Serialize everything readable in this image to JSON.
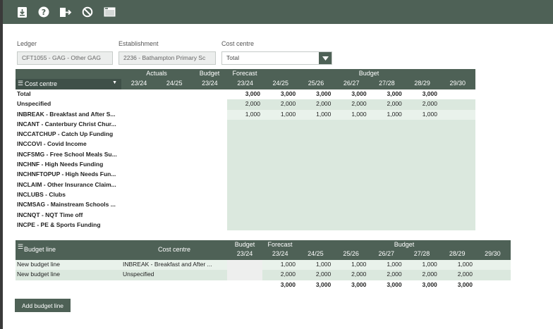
{
  "toolbar": {
    "icons": [
      "download-icon",
      "help-icon",
      "export-icon",
      "cancel-icon",
      "window-icon"
    ]
  },
  "filters": {
    "ledger": {
      "label": "Ledger",
      "value": "CFT1055 - GAG - Other GAG"
    },
    "establishment": {
      "label": "Establishment",
      "value": "2236 - Bathampton Primary Sc"
    },
    "cost_centre": {
      "label": "Cost centre",
      "value": "Total"
    }
  },
  "top_grid": {
    "groups": {
      "actuals": "Actuals",
      "budget": "Budget",
      "forecast": "Forecast",
      "budget2": "Budget"
    },
    "first_col": "Cost centre",
    "years": [
      "23/24",
      "24/25",
      "23/24",
      "23/24",
      "24/25",
      "25/26",
      "26/27",
      "27/28",
      "28/29",
      "29/30"
    ],
    "rows": [
      {
        "label": "Total",
        "bold": true,
        "values": [
          "3,000",
          "3,000",
          "3,000",
          "3,000",
          "3,000",
          "3,000"
        ]
      },
      {
        "label": "Unspecified",
        "values": [
          "2,000",
          "2,000",
          "2,000",
          "2,000",
          "2,000",
          "2,000"
        ]
      },
      {
        "label": "INBREAK - Breakfast and After S...",
        "values": [
          "1,000",
          "1,000",
          "1,000",
          "1,000",
          "1,000",
          "1,000"
        ]
      },
      {
        "label": "INCANT - Canterbury Christ Chur...",
        "values": []
      },
      {
        "label": "INCCATCHUP - Catch Up Funding",
        "values": []
      },
      {
        "label": "INCCOVI - Covid Income",
        "values": []
      },
      {
        "label": "INCFSMG - Free School Meals Su...",
        "values": []
      },
      {
        "label": "INCHNF - High Needs Funding",
        "values": []
      },
      {
        "label": "INCHNFTOPUP - High Needs Fun...",
        "values": []
      },
      {
        "label": "INCLAIM - Other Insurance Claim...",
        "values": []
      },
      {
        "label": "INCLUBS - Clubs",
        "values": []
      },
      {
        "label": "INCMSAG - Mainstream Schools ...",
        "values": []
      },
      {
        "label": "INCNQT - NQT Time off",
        "values": []
      },
      {
        "label": "INCPE - PE & Sports Funding",
        "values": []
      }
    ]
  },
  "bottom_grid": {
    "col_budget_line": "Budget line",
    "col_cost_centre": "Cost centre",
    "groups": {
      "budget": "Budget",
      "forecast": "Forecast",
      "budget2": "Budget"
    },
    "years": [
      "23/24",
      "23/24",
      "24/25",
      "25/26",
      "26/27",
      "27/28",
      "28/29",
      "29/30"
    ],
    "rows": [
      {
        "line": "New budget line",
        "cost_centre": "INBREAK - Breakfast and After ...",
        "values": [
          "1,000",
          "1,000",
          "1,000",
          "1,000",
          "1,000",
          "1,000"
        ]
      },
      {
        "line": "New budget line",
        "cost_centre": "Unspecified",
        "values": [
          "2,000",
          "2,000",
          "2,000",
          "2,000",
          "2,000",
          "2,000"
        ]
      }
    ],
    "totals": [
      "3,000",
      "3,000",
      "3,000",
      "3,000",
      "3,000",
      "3,000"
    ]
  },
  "add_button": "Add budget line"
}
